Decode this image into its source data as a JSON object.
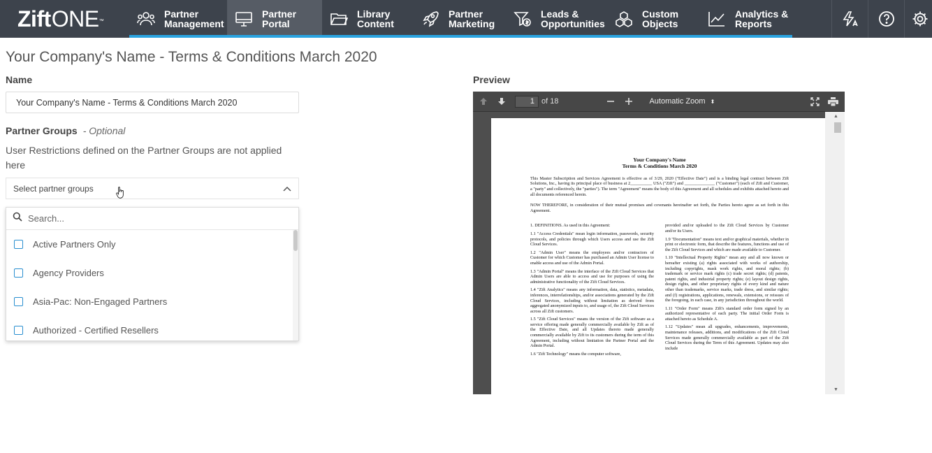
{
  "brand": {
    "logo_bold": "Zift",
    "logo_thin": "ONE",
    "tm": "™"
  },
  "nav": {
    "items": [
      {
        "label": "Partner\nManagement",
        "icon": "partners-icon",
        "active": false
      },
      {
        "label": "Partner\nPortal",
        "icon": "monitor-icon",
        "active": true
      },
      {
        "label": "Library\nContent",
        "icon": "folder-icon",
        "active": false
      },
      {
        "label": "Partner\nMarketing",
        "icon": "rocket-icon",
        "active": false
      },
      {
        "label": "Leads &\nOpportunities",
        "icon": "funnel-dollar-icon",
        "active": false
      },
      {
        "label": "Custom\nObjects",
        "icon": "cubes-icon",
        "active": false
      },
      {
        "label": "Analytics &\nReports",
        "icon": "line-chart-icon",
        "active": false
      }
    ]
  },
  "page": {
    "title": "Your Company's Name - Terms & Conditions March 2020"
  },
  "form": {
    "name_label": "Name",
    "name_value": "Your Company's Name - Terms & Conditions March 2020",
    "groups_label": "Partner Groups",
    "groups_optional": "- Optional",
    "groups_help": "User Restrictions defined on the Partner Groups are not applied here",
    "groups_placeholder": "Select partner groups",
    "search_placeholder": "Search...",
    "options": [
      "Active Partners Only",
      "Agency Providers",
      "Asia-Pac: Non-Engaged Partners",
      "Authorized - Certified Resellers"
    ]
  },
  "preview": {
    "label": "Preview",
    "page_current": "1",
    "page_total": "of 18",
    "zoom": "Automatic Zoom",
    "doc": {
      "company": "Your Company's Name",
      "subtitle": "Terms & Conditions March 2020",
      "intro": "This Master Subscription and Services Agreement is effective as of 3/29, 2020 (\"Effective Date\") and is a binding legal contract between Zift Solutions, Inc., having its principal place of business at 2__________ USA (\"Zift\") and ______________ (\"Customer\") (each of Zift and Customer, a \"party\" and collectively, the \"parties\"). The term \"Agreement\" means the body of this Agreement and all schedules and exhibits attached hereto and all documents referenced herein.",
      "therefore": "NOW THEREFORE, in consideration of their mutual promises and covenants hereinafter set forth, the Parties hereto agree as set forth in this Agreement.",
      "col1": [
        "1. DEFINITIONS. As used in this Agreement:",
        "1.1 \"Access Credentials\" mean login information, passwords, security protocols, and policies through which Users access and use the Zift Cloud Services.",
        "1.2 \"Admin User\" means the employees and/or contractors of Customer for which Customer has purchased an Admin User license to enable access and use of the Admin Portal.",
        "1.3 \"Admin Portal\" means the interface of the Zift Cloud Services that Admin Users are able to access and use for purposes of using the administrative functionality of the Zift Cloud Services.",
        "1.4 \"Zift Analytics\" means any information, data, statistics, metadata, inferences, interrelationships, and/or associations generated by the Zift Cloud Services, including without limitation as derived from aggregated anonymized inputs to, and usage of, the Zift Cloud Services across all Zift customers.",
        "1.5 \"Zift Cloud Services\" means the version of the Zift software as a service offering made generally commercially available by Zift as of the Effective Date, and all Updates thereto made generally commercially available by Zift to its customers during the term of this Agreement, including without limitation the Partner Portal and the Admin Portal.",
        "1.6 \"Zift Technology\" means the computer software,"
      ],
      "col2": [
        "provided and/or uploaded to the Zift Cloud Services by Customer and/or its Users.",
        "1.9 \"Documentation\" means text and/or graphical materials, whether in print or electronic form, that describe the features, functions and use of the Zift Cloud Services and which are made available to Customer.",
        "1.10 \"Intellectual Property Rights\" mean any and all now known or hereafter existing (a) rights associated with works of authorship, including copyrights, mask work rights, and moral rights; (b) trademark or service mark rights (c) trade secret rights; (d) patents, patent rights, and industrial property rights; (e) layout design rights, design rights, and other proprietary rights of every kind and nature other than trademarks, service marks, trade dress, and similar rights; and (f) registrations, applications, renewals, extensions, or reissues of the foregoing, in each case, in any jurisdiction throughout the world.",
        "1.11 \"Order Form\" means Zift's standard order form signed by an authorized representative of each party. The initial Order Form is attached hereto as Schedule A.",
        "1.12 \"Updates\" mean all upgrades, enhancements, improvements, maintenance releases, additions, and modifications of the Zift Cloud Services made generally commercially available as part of the Zift Cloud Services during the Term of this Agreement. Updates may also include"
      ]
    }
  },
  "colors": {
    "nav_bg": "#3d434c",
    "nav_active": "#565c65",
    "accent": "#2aa3e0",
    "checkbox": "#2a8fd0"
  }
}
